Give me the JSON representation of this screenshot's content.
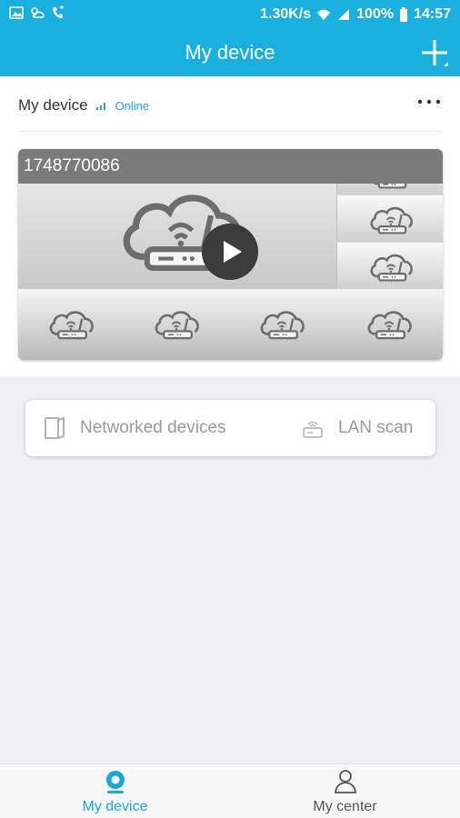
{
  "status_bar": {
    "speed": "1.30K/s",
    "battery": "100%",
    "time": "14:57"
  },
  "app_bar": {
    "title": "My device"
  },
  "device": {
    "name": "My device",
    "status": "Online",
    "serial": "1748770086"
  },
  "actions": [
    {
      "label": "Networked devices",
      "icon": "door-icon"
    },
    {
      "label": "LAN scan",
      "icon": "router-scan-icon"
    }
  ],
  "nav": [
    {
      "label": "My device",
      "icon": "camera-icon",
      "active": true
    },
    {
      "label": "My center",
      "icon": "person-icon",
      "active": false
    }
  ],
  "colors": {
    "primary": "#19b0e0",
    "active_nav": "#19a8da",
    "inactive_nav": "#666666"
  }
}
